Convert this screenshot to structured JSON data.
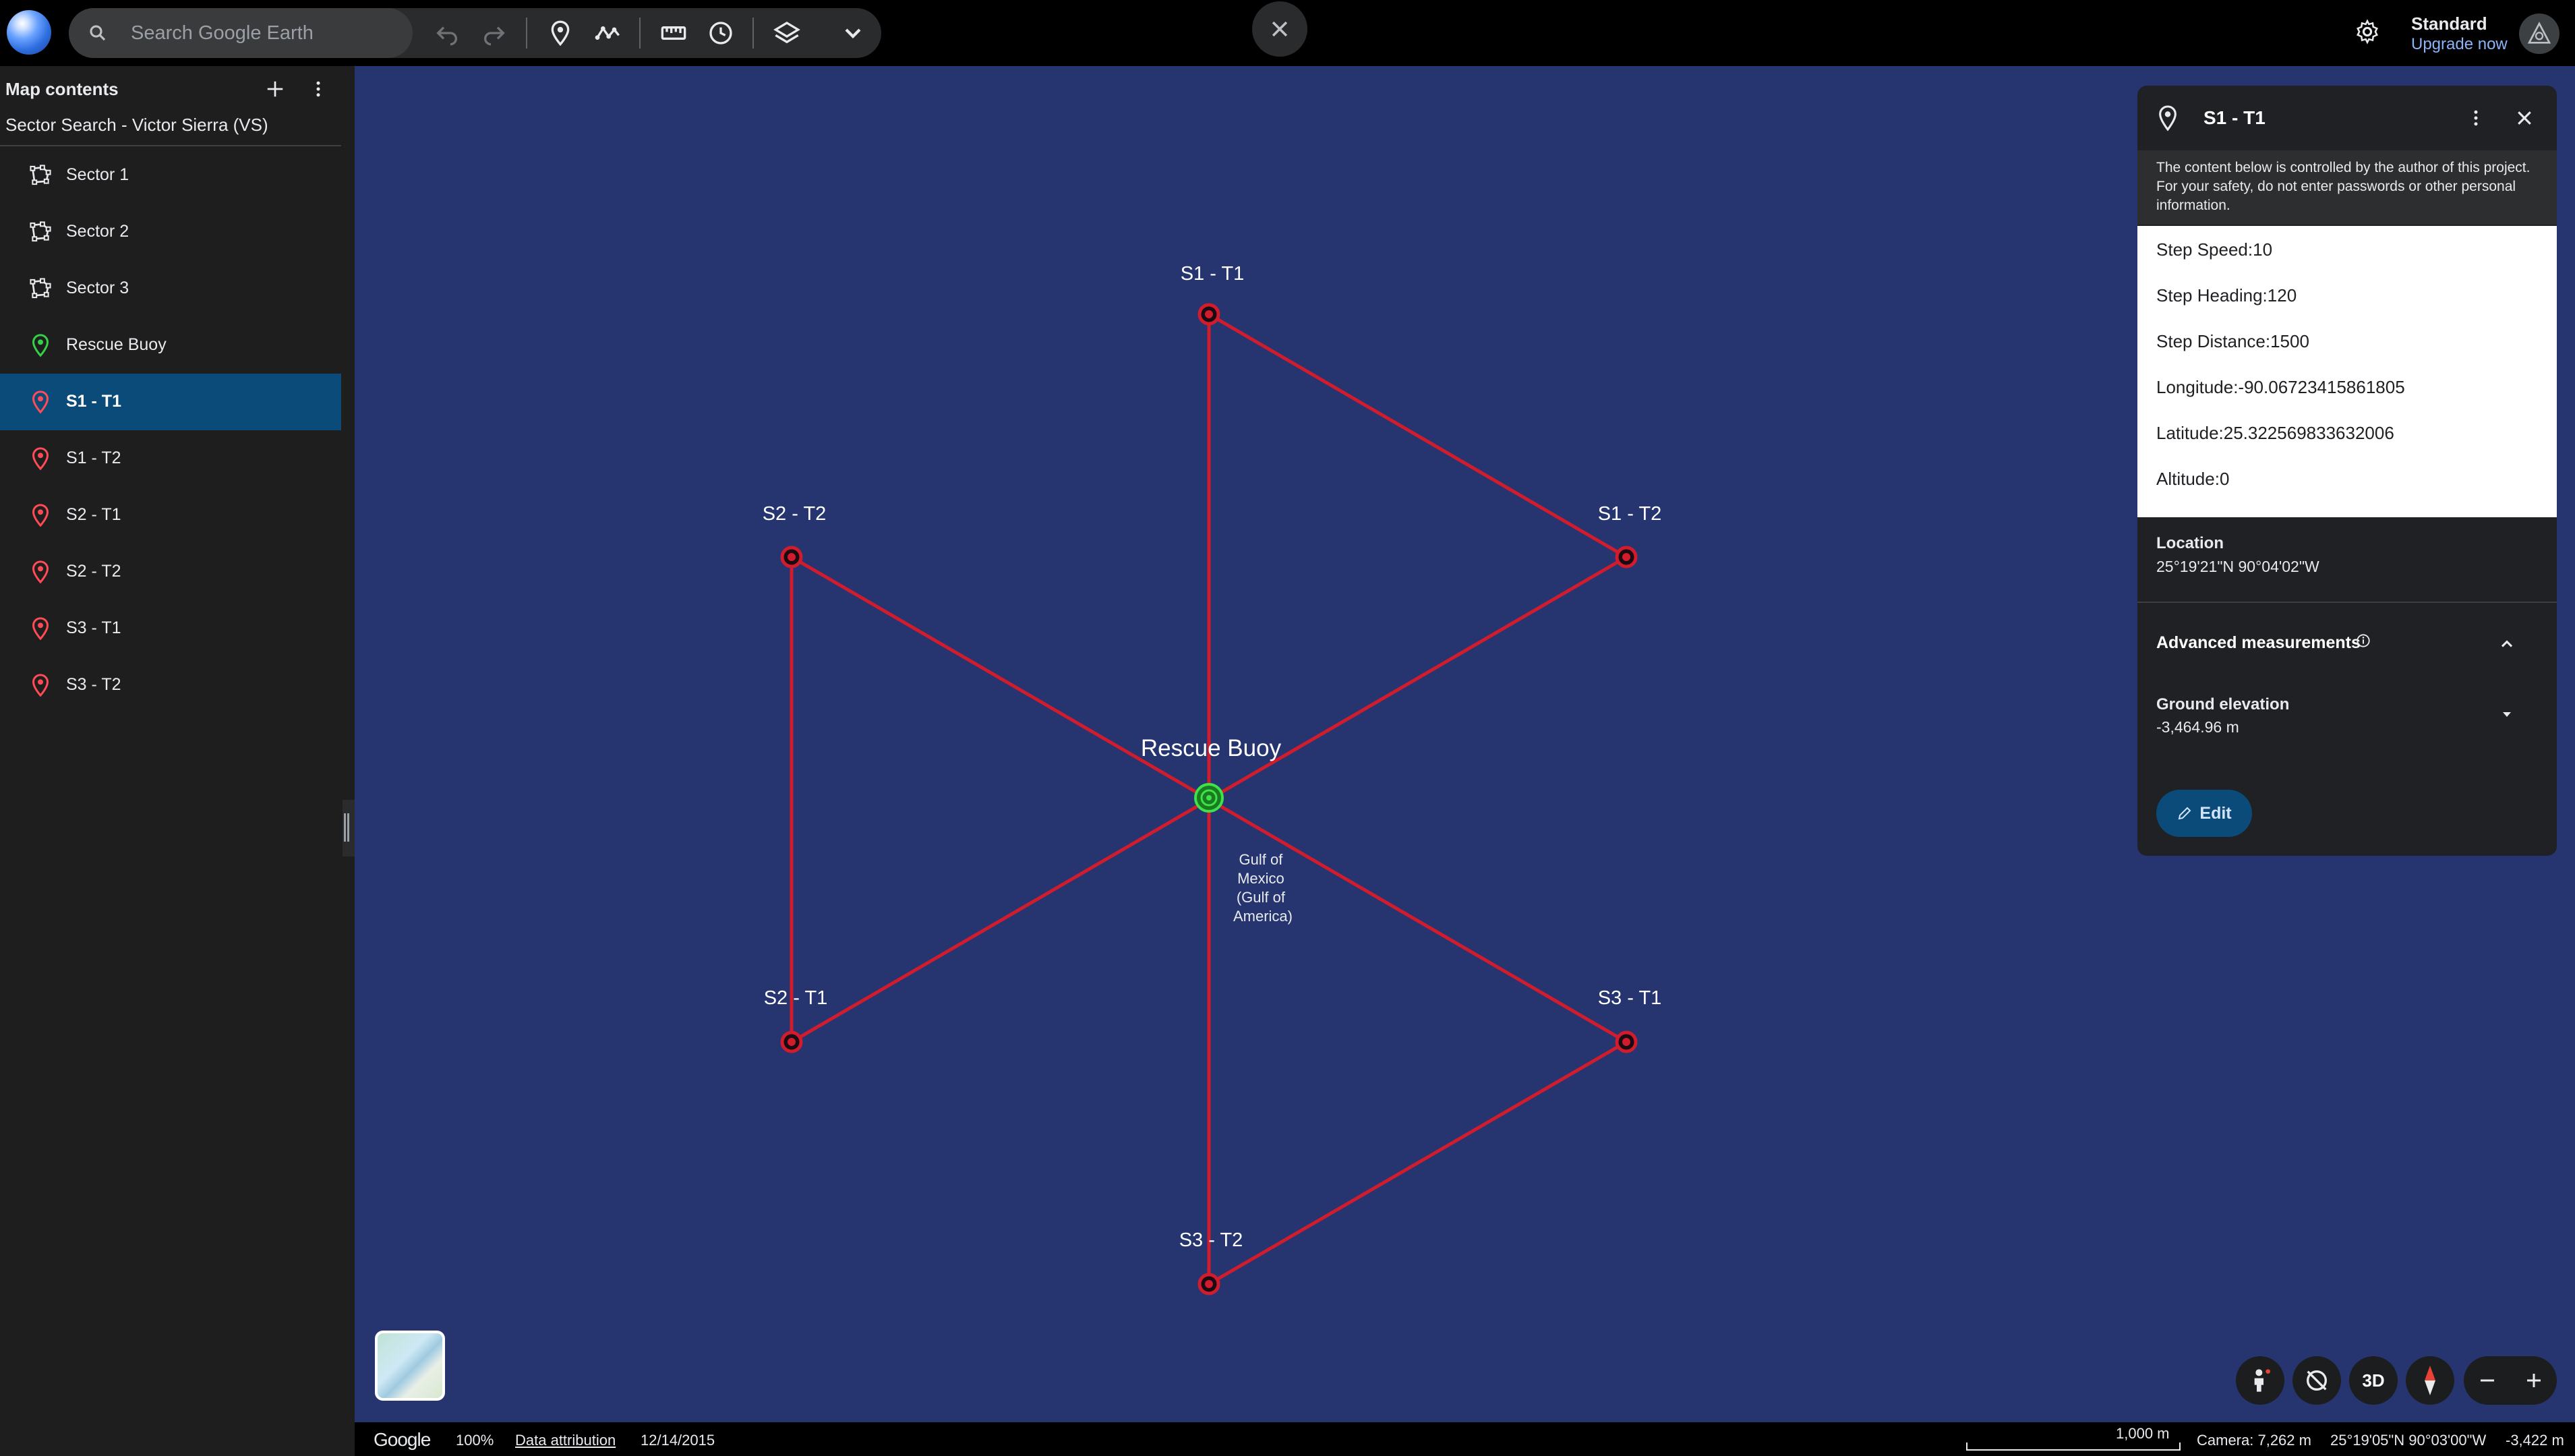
{
  "search": {
    "placeholder": "Search Google Earth"
  },
  "toolbar": {
    "icons": [
      "search-icon",
      "undo-icon",
      "redo-icon",
      "add-placemark-icon",
      "draw-path-icon",
      "measure-icon",
      "history-icon",
      "layers-icon",
      "chevron-down-icon",
      "close-icon"
    ]
  },
  "account": {
    "plan": "Standard",
    "upgrade": "Upgrade now"
  },
  "panel": {
    "title": "Map contents",
    "project": "Sector Search - Victor Sierra (VS)",
    "items": [
      {
        "label": "Sector 1",
        "icon": "polygon-icon",
        "active": false
      },
      {
        "label": "Sector 2",
        "icon": "polygon-icon",
        "active": false
      },
      {
        "label": "Sector 3",
        "icon": "polygon-icon",
        "active": false
      },
      {
        "label": "Rescue Buoy",
        "icon": "green-pin-icon",
        "active": false
      },
      {
        "label": "S1 - T1",
        "icon": "red-pin-icon",
        "active": true
      },
      {
        "label": "S1 - T2",
        "icon": "red-pin-icon",
        "active": false
      },
      {
        "label": "S2 - T1",
        "icon": "red-pin-icon",
        "active": false
      },
      {
        "label": "S2 - T2",
        "icon": "red-pin-icon",
        "active": false
      },
      {
        "label": "S3 - T1",
        "icon": "red-pin-icon",
        "active": false
      },
      {
        "label": "S3 - T2",
        "icon": "red-pin-icon",
        "active": false
      }
    ]
  },
  "map": {
    "center_label": "Rescue Buoy",
    "water_label": [
      "Gulf of",
      "Mexico",
      "(Gulf of",
      "America)"
    ],
    "point_labels": {
      "s1t1": "S1 - T1",
      "s1t2": "S1 - T2",
      "s2t1": "S2 - T1",
      "s2t2": "S2 - T2",
      "s3t1": "S3 - T1",
      "s3t2": "S3 - T2"
    },
    "colors": {
      "water": "#263570",
      "track": "#d01c2c",
      "buoy": "#2ecc40"
    }
  },
  "controls": {
    "view_3d": "3D"
  },
  "status": {
    "brand": "Google",
    "zoom": "100%",
    "attribution": "Data attribution",
    "date": "12/14/2015",
    "scale": "1,000 m",
    "camera": "Camera: 7,262 m",
    "coords": "25°19'05\"N 90°03'00\"W",
    "elevation": "-3,422 m"
  },
  "card": {
    "title": "S1 - T1",
    "warning": "The content below is controlled by the author of this project. For your safety, do not enter passwords or other personal information.",
    "fields": [
      "Step Speed:10",
      "Step Heading:120",
      "Step Distance:1500",
      "Longitude:-90.06723415861805",
      "Latitude:25.322569833632006",
      "Altitude:0"
    ],
    "location_label": "Location",
    "location_value": "25°19'21\"N 90°04'02\"W",
    "advanced_label": "Advanced measurements",
    "ground_label": "Ground elevation",
    "ground_value": "-3,464.96 m",
    "edit_label": "Edit"
  }
}
